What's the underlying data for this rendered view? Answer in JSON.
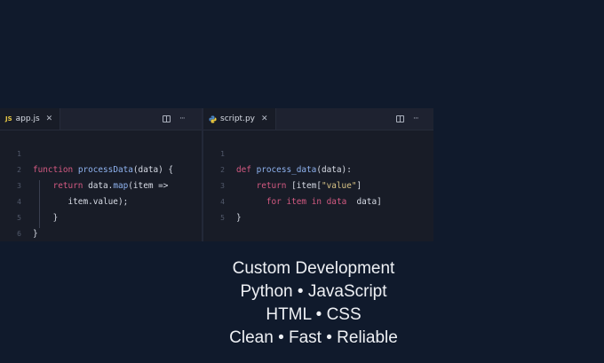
{
  "editor": {
    "left_tab": {
      "icon_text": "JS",
      "filename": "app.js",
      "close": "✕",
      "more": "···"
    },
    "right_tab": {
      "filename": "script.py",
      "close": "✕",
      "more": "···"
    }
  },
  "code_left": {
    "line_numbers": [
      "1",
      "2",
      "3",
      "4",
      "5",
      "6"
    ]
  },
  "code_right": {
    "line_numbers": [
      "1",
      "2",
      "3",
      "4",
      "5"
    ]
  },
  "captions": [
    "Custom Development",
    "Python • JavaScript",
    "HTML • CSS",
    "Clean • Fast • Reliable"
  ],
  "colors": {
    "background": "#101a2c",
    "editor_bg": "#181c27",
    "keyword": "#d45a82",
    "function": "#8fb3f0",
    "string": "#d9c486",
    "js_badge": "#e8c845"
  },
  "icons": [
    "js-file-icon",
    "python-file-icon",
    "close-icon",
    "split-editor-icon",
    "more-actions-icon"
  ]
}
